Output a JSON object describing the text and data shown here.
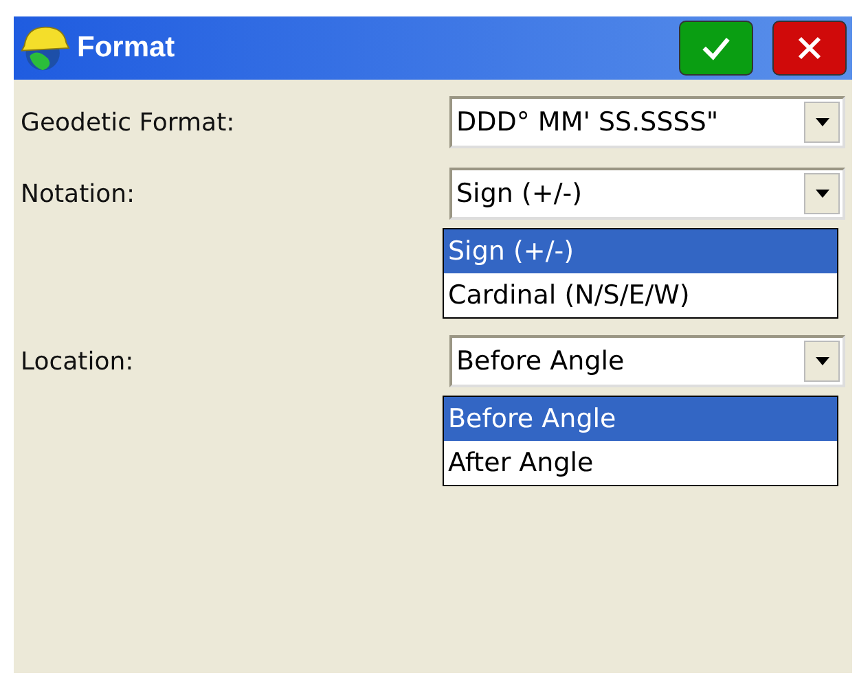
{
  "window": {
    "title": "Format"
  },
  "title_buttons": [
    {
      "kind": "ok"
    },
    {
      "kind": "cancel"
    }
  ],
  "fields": [
    {
      "label": "Geodetic Format:",
      "value": "DDD° MM' SS.SSSS\""
    },
    {
      "label": "Notation:",
      "value": "Sign (+/-)",
      "options": [
        {
          "label": "Sign (+/-)",
          "selected": true
        },
        {
          "label": "Cardinal (N/S/E/W)",
          "selected": false
        }
      ]
    },
    {
      "label": "Location:",
      "value": "Before Angle",
      "options": [
        {
          "label": "Before Angle",
          "selected": true
        },
        {
          "label": "After Angle",
          "selected": false
        }
      ]
    }
  ]
}
